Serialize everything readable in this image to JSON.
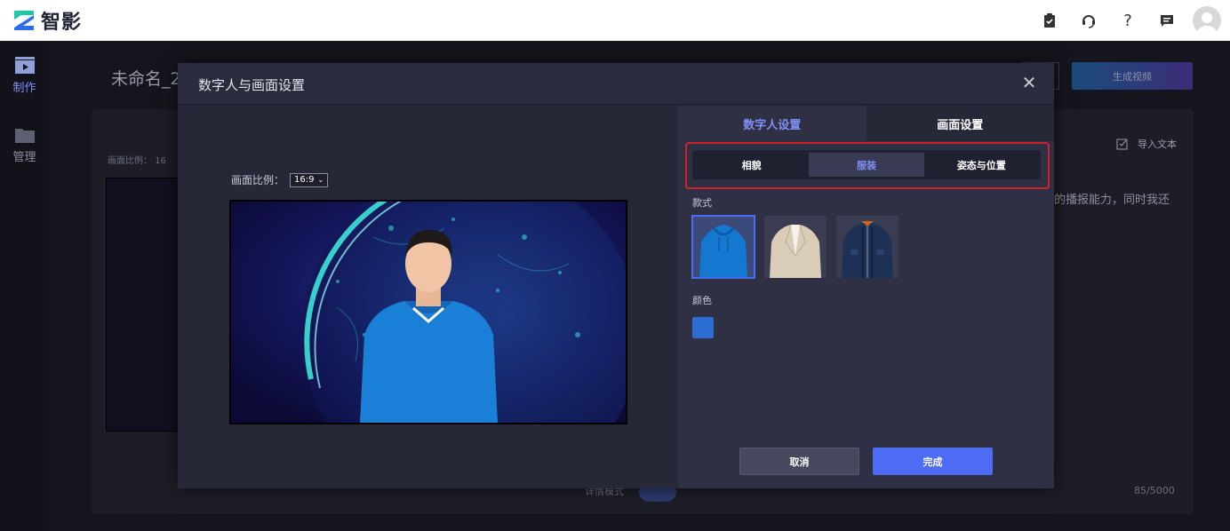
{
  "app": {
    "name": "智影"
  },
  "colors": {
    "accent": "#4e6bf4",
    "highlight_border": "#d0202a",
    "swatch": "#2b6fd3"
  },
  "topbar": {
    "icons": [
      "clipboard-icon",
      "headset-icon",
      "help-icon",
      "message-icon",
      "avatar"
    ],
    "help_glyph": "?"
  },
  "rail": {
    "items": [
      {
        "label": "制作",
        "icon": "film-icon"
      },
      {
        "label": "管理",
        "icon": "folder-icon"
      }
    ]
  },
  "background": {
    "project_title": "未命名_2",
    "ratio_label": "画面比例：",
    "ratio_value": "16",
    "generate_button": "生成视频",
    "import_text": "导入文本",
    "script_excerpt": "的播报能力，同时我还",
    "char_count": "85/5000",
    "mode_label": "详情模式"
  },
  "modal": {
    "title": "数字人与画面设置",
    "close_glyph": "✕",
    "ratio_label": "画面比例：",
    "ratio_value": "16:9",
    "tabs": [
      {
        "label": "数字人设置",
        "active": true
      },
      {
        "label": "画面设置",
        "active": false
      }
    ],
    "sub_tabs": [
      {
        "label": "相貌",
        "active": false
      },
      {
        "label": "服装",
        "active": true
      },
      {
        "label": "姿态与位置",
        "active": false
      }
    ],
    "style_label": "款式",
    "styles": [
      {
        "name": "blue-hoodie",
        "selected": true
      },
      {
        "name": "beige-blazer",
        "selected": false
      },
      {
        "name": "navy-jacket",
        "selected": false
      }
    ],
    "color_label": "颜色",
    "cancel_button": "取消",
    "confirm_button": "完成"
  }
}
